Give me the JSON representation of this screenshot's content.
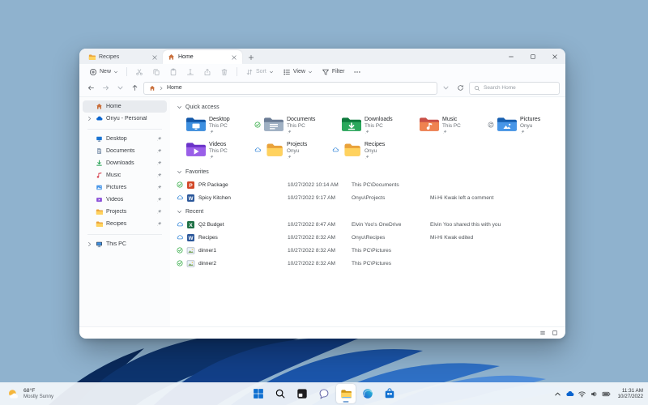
{
  "colors": {
    "desktop_bg": "#8fb2ce",
    "accent": "#0067c0",
    "taskbar_bg": "#f2f5fa",
    "selection": "#e8ebef",
    "status_green": "#18a02c",
    "cloud_blue": "#1a77d4",
    "folder_yellow": "#ffd25e"
  },
  "window": {
    "tabs": [
      {
        "label": "Recipes",
        "icon": "folder-plain-icon",
        "active": false
      },
      {
        "label": "Home",
        "icon": "home-icon",
        "active": true
      }
    ],
    "toolbar": {
      "new_label": "New",
      "sort_label": "Sort",
      "view_label": "View",
      "filter_label": "Filter"
    },
    "address": {
      "breadcrumb": "Home",
      "search_placeholder": "Search Home"
    },
    "sidebar": {
      "items": [
        {
          "label": "Home",
          "icon": "home-icon",
          "selected": true,
          "expandable": false,
          "pinned": false,
          "gap_before": false
        },
        {
          "label": "Onyu - Personal",
          "icon": "onedrive-icon",
          "selected": false,
          "expandable": true,
          "pinned": false,
          "gap_before": false
        },
        {
          "label": "Desktop",
          "icon": "desktop-icon",
          "selected": false,
          "expandable": false,
          "pinned": true,
          "gap_before": true
        },
        {
          "label": "Documents",
          "icon": "documents-icon",
          "selected": false,
          "expandable": false,
          "pinned": true,
          "gap_before": false
        },
        {
          "label": "Downloads",
          "icon": "downloads-icon",
          "selected": false,
          "expandable": false,
          "pinned": true,
          "gap_before": false
        },
        {
          "label": "Music",
          "icon": "music-icon",
          "selected": false,
          "expandable": false,
          "pinned": true,
          "gap_before": false
        },
        {
          "label": "Pictures",
          "icon": "pictures-icon",
          "selected": false,
          "expandable": false,
          "pinned": true,
          "gap_before": false
        },
        {
          "label": "Videos",
          "icon": "videos-icon",
          "selected": false,
          "expandable": false,
          "pinned": true,
          "gap_before": false
        },
        {
          "label": "Projects",
          "icon": "folder-plain-icon",
          "selected": false,
          "expandable": false,
          "pinned": true,
          "gap_before": false
        },
        {
          "label": "Recipes",
          "icon": "folder-plain-icon",
          "selected": false,
          "expandable": false,
          "pinned": true,
          "gap_before": false
        },
        {
          "label": "This PC",
          "icon": "this-pc-icon",
          "selected": false,
          "expandable": true,
          "pinned": false,
          "gap_before": true
        }
      ]
    },
    "sections": {
      "quick_access": {
        "title": "Quick access",
        "tiles": [
          {
            "name": "Desktop",
            "location": "This PC",
            "icon": "folder-desktop-icon",
            "status_icon": null,
            "pinned": true
          },
          {
            "name": "Documents",
            "location": "This PC",
            "icon": "folder-documents-icon",
            "status_icon": "synced-check-icon",
            "pinned": true
          },
          {
            "name": "Downloads",
            "location": "This PC",
            "icon": "folder-downloads-icon",
            "status_icon": null,
            "pinned": true
          },
          {
            "name": "Music",
            "location": "This PC",
            "icon": "folder-music-icon",
            "status_icon": null,
            "pinned": true
          },
          {
            "name": "Pictures",
            "location": "Onyu",
            "icon": "folder-pictures-icon",
            "status_icon": "sync-pending-icon",
            "pinned": true
          },
          {
            "name": "Videos",
            "location": "This PC",
            "icon": "folder-videos-icon",
            "status_icon": null,
            "pinned": true
          },
          {
            "name": "Projects",
            "location": "Onyu",
            "icon": "folder-plain-icon",
            "status_icon": "cloud-icon",
            "pinned": true
          },
          {
            "name": "Recipes",
            "location": "Onyu",
            "icon": "folder-plain-icon",
            "status_icon": "cloud-icon",
            "pinned": true
          }
        ]
      },
      "favorites": {
        "title": "Favorites",
        "rows": [
          {
            "name": "PR Package",
            "date": "10/27/2022 10:14 AM",
            "location": "This PC\\Documents",
            "activity": "",
            "icon": "powerpoint-icon",
            "status_icon": "synced-check-icon"
          },
          {
            "name": "Spicy Kitchen",
            "date": "10/27/2022 9:17 AM",
            "location": "Onyu\\Projects",
            "activity": "Mi-Hi Kwak left a comment",
            "icon": "word-icon",
            "status_icon": "cloud-icon"
          }
        ]
      },
      "recent": {
        "title": "Recent",
        "rows": [
          {
            "name": "Q2 Budget",
            "date": "10/27/2022 8:47 AM",
            "location": "Elvin Yoo's OneDrive",
            "activity": "Elvin Yoo shared this with you",
            "icon": "excel-icon",
            "status_icon": "cloud-icon"
          },
          {
            "name": "Recipes",
            "date": "10/27/2022 8:32 AM",
            "location": "Onyu\\Recipes",
            "activity": "Mi-Hi Kwak edited",
            "icon": "word-icon",
            "status_icon": "cloud-icon"
          },
          {
            "name": "dinner1",
            "date": "10/27/2022 8:32 AM",
            "location": "This PC\\Pictures",
            "activity": "",
            "icon": "image-file-icon",
            "status_icon": "synced-check-icon"
          },
          {
            "name": "dinner2",
            "date": "10/27/2022 8:32 AM",
            "location": "This PC\\Pictures",
            "activity": "",
            "icon": "image-file-icon",
            "status_icon": "synced-check-icon"
          }
        ]
      }
    }
  },
  "taskbar": {
    "weather": {
      "temp": "68°F",
      "condition": "Mostly Sunny"
    },
    "center_icons": [
      {
        "name": "start-icon",
        "active": false
      },
      {
        "name": "search-icon",
        "active": false
      },
      {
        "name": "task-view-icon",
        "active": false
      },
      {
        "name": "chat-icon",
        "active": false
      },
      {
        "name": "file-explorer-icon",
        "active": true
      },
      {
        "name": "edge-icon",
        "active": false
      },
      {
        "name": "store-icon",
        "active": false
      }
    ],
    "tray_icons": [
      {
        "name": "chevron-up-icon"
      },
      {
        "name": "onedrive-icon"
      },
      {
        "name": "wifi-icon"
      },
      {
        "name": "volume-icon"
      },
      {
        "name": "battery-icon"
      }
    ],
    "clock": {
      "time": "11:31 AM",
      "date": "10/27/2022"
    }
  }
}
